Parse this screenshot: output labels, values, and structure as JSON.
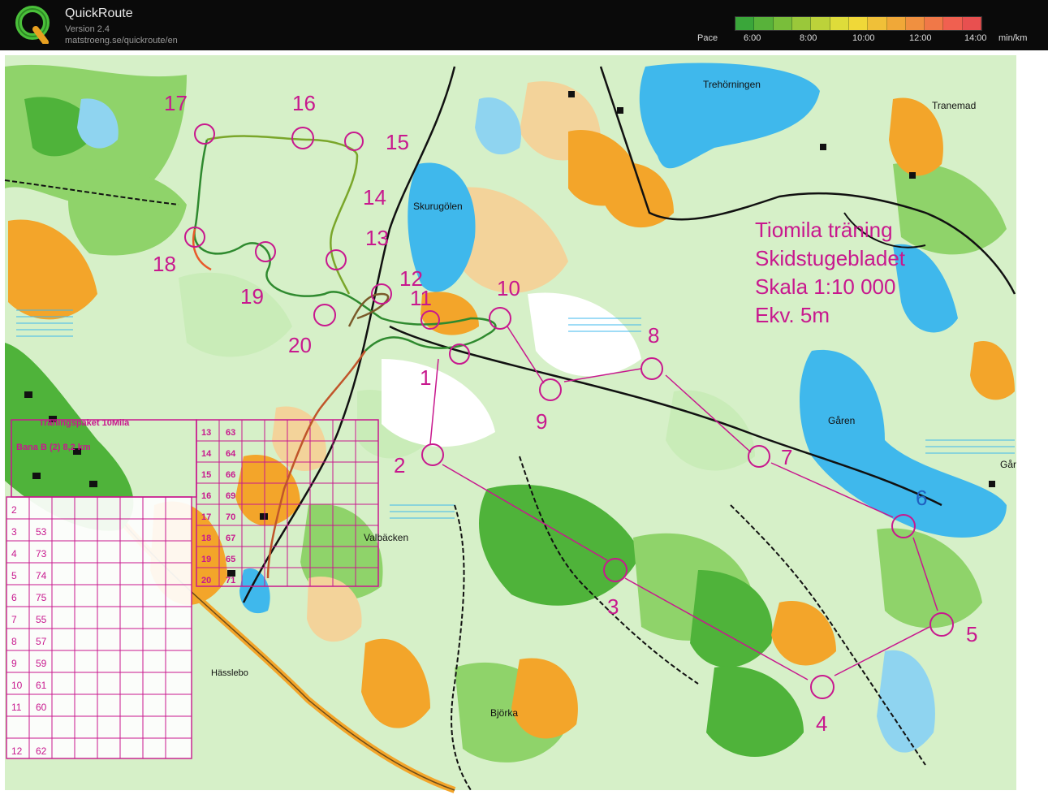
{
  "app": {
    "title": "QuickRoute",
    "version": "Version 2.4",
    "url": "matstroeng.se/quickroute/en"
  },
  "pace_legend": {
    "label": "Pace",
    "ticks": [
      "6:00",
      "8:00",
      "10:00",
      "12:00",
      "14:00"
    ],
    "unit": "min/km",
    "colors": [
      "#3aa63a",
      "#58b23a",
      "#79be3a",
      "#9ac83a",
      "#bcd23a",
      "#dedc3a",
      "#f0d838",
      "#f0c038",
      "#f0a838",
      "#f09040",
      "#f07848",
      "#f06050",
      "#e85050"
    ]
  },
  "map": {
    "colors": {
      "paper": "#ffffff",
      "forest_light": "#c9ecb8",
      "forest": "#8fd36a",
      "forest_dark": "#4fb33a",
      "open": "#f3d39a",
      "open_strong": "#f3a52a",
      "water": "#3fb8ec",
      "course": "#c8188e",
      "route": "#2f8a2f",
      "road": "#111111"
    },
    "title_lines": [
      "Tiomila träning",
      "Skidstugebladet",
      "Skala 1:10 000",
      "Ekv. 5m"
    ],
    "place_names": [
      "Trehörningen",
      "Tranemad",
      "Skurugölen",
      "Gåren",
      "Valbäcken",
      "Hässlebo",
      "Björka",
      "Går"
    ],
    "controls": [
      "1",
      "2",
      "3",
      "4",
      "5",
      "6",
      "7",
      "8",
      "9",
      "10",
      "11",
      "12",
      "13",
      "14",
      "15",
      "16",
      "17",
      "18",
      "19",
      "20"
    ],
    "description_title": "Träningspaket 10Mila",
    "description_subtitle": "Bana B (2)   8,2 km",
    "description_rows": [
      {
        "no": "2",
        "code": ""
      },
      {
        "no": "3",
        "code": "53"
      },
      {
        "no": "4",
        "code": "73"
      },
      {
        "no": "5",
        "code": "74"
      },
      {
        "no": "6",
        "code": "75"
      },
      {
        "no": "7",
        "code": "55"
      },
      {
        "no": "8",
        "code": "57"
      },
      {
        "no": "9",
        "code": "59"
      },
      {
        "no": "10",
        "code": "61"
      },
      {
        "no": "11",
        "code": "60"
      },
      {
        "no": "",
        "code": ""
      },
      {
        "no": "12",
        "code": "62"
      }
    ],
    "description_rows_upper": [
      {
        "no": "13",
        "code": "63"
      },
      {
        "no": "14",
        "code": "64"
      },
      {
        "no": "15",
        "code": "66"
      },
      {
        "no": "16",
        "code": "69"
      },
      {
        "no": "17",
        "code": "70"
      },
      {
        "no": "18",
        "code": "67"
      },
      {
        "no": "19",
        "code": "65"
      },
      {
        "no": "20",
        "code": "71"
      }
    ]
  }
}
